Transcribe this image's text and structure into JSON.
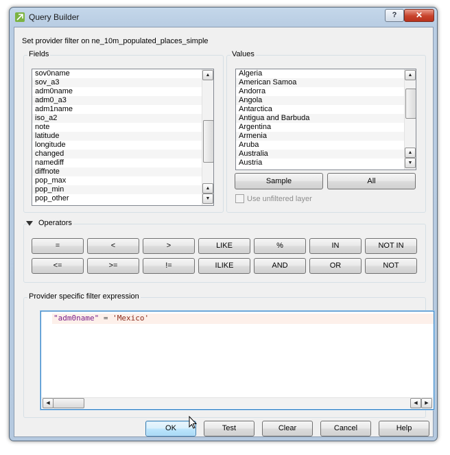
{
  "window": {
    "title": "Query Builder"
  },
  "filter_description": "Set provider filter on ne_10m_populated_places_simple",
  "fields": {
    "title": "Fields",
    "items": [
      "sov0name",
      "sov_a3",
      "adm0name",
      "adm0_a3",
      "adm1name",
      "iso_a2",
      "note",
      "latitude",
      "longitude",
      "changed",
      "namediff",
      "diffnote",
      "pop_max",
      "pop_min",
      "pop_other"
    ]
  },
  "values": {
    "title": "Values",
    "items": [
      "Algeria",
      "American Samoa",
      "Andorra",
      "Angola",
      "Antarctica",
      "Antigua and Barbuda",
      "Argentina",
      "Armenia",
      "Aruba",
      "Australia",
      "Austria"
    ],
    "sample_label": "Sample",
    "all_label": "All",
    "use_unfiltered_label": "Use unfiltered layer"
  },
  "operators": {
    "title": "Operators",
    "row1": [
      "=",
      "<",
      ">",
      "LIKE",
      "%",
      "IN",
      "NOT IN"
    ],
    "row2": [
      "<=",
      ">=",
      "!=",
      "ILIKE",
      "AND",
      "OR",
      "NOT"
    ]
  },
  "expression": {
    "title": "Provider specific filter expression",
    "field": "\"adm0name\"",
    "operator": " = ",
    "value": "'Mexico'"
  },
  "buttons": {
    "ok": "OK",
    "test": "Test",
    "clear": "Clear",
    "cancel": "Cancel",
    "help": "Help"
  },
  "colors": {
    "accent": "#3a86c8",
    "close": "#c7422b",
    "selection_line": "#fdf0ea"
  }
}
